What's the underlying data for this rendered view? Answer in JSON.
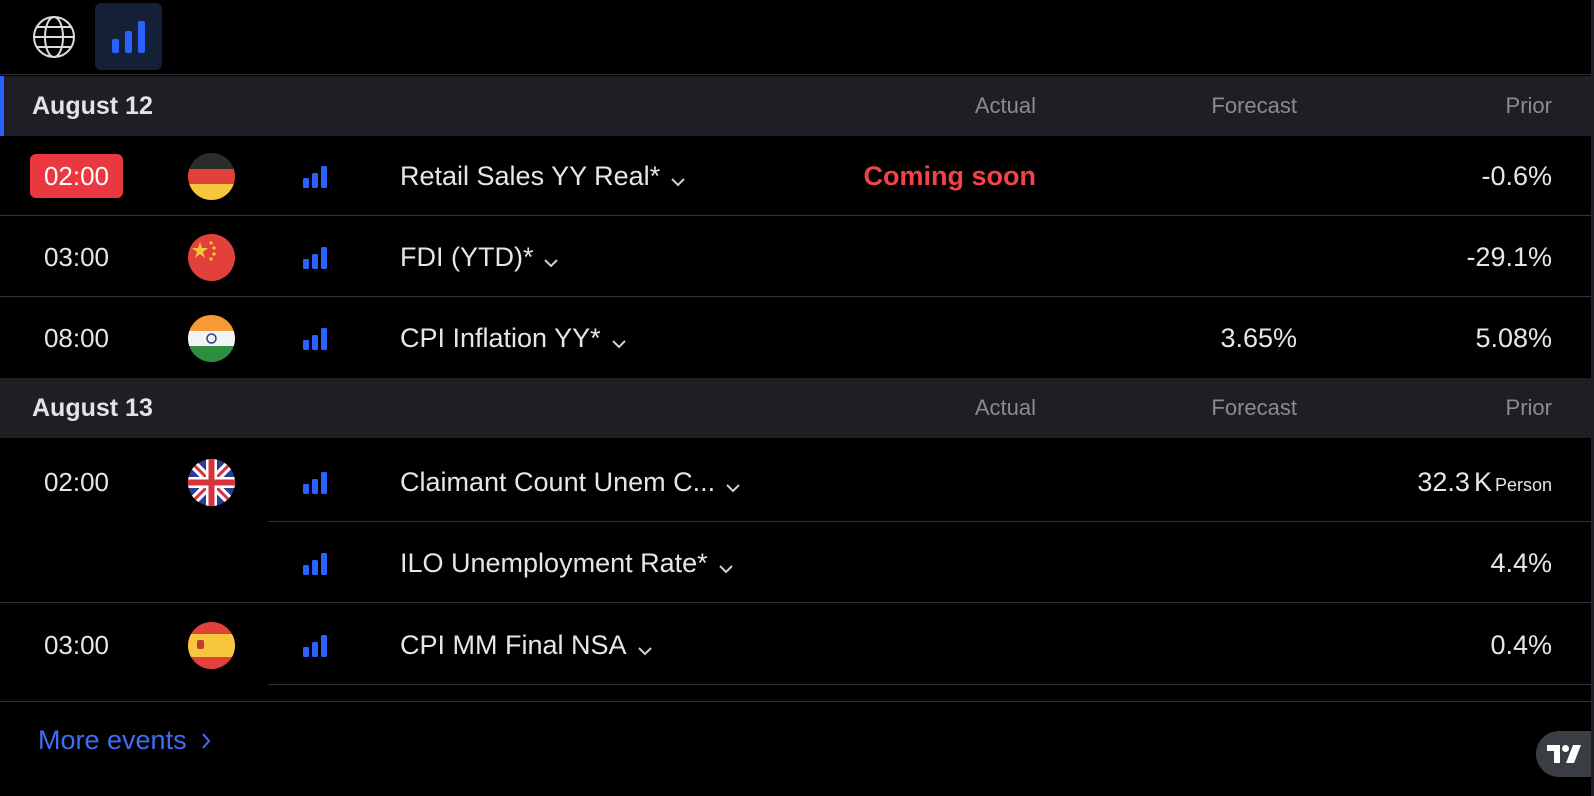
{
  "colors": {
    "accent": "#2962ff",
    "live": "#e9383f",
    "coming_soon": "#f2434a",
    "link": "#3f6ef5"
  },
  "toolbar": {
    "icons": [
      "globe-icon",
      "importance-bars-icon"
    ]
  },
  "days": [
    {
      "title": "August 12",
      "columns": {
        "actual": "Actual",
        "forecast": "Forecast",
        "prior": "Prior"
      },
      "events": [
        {
          "time": "02:00",
          "live": true,
          "country_icon": "germany-flag-icon",
          "name": "Retail Sales YY Real*",
          "actual": "Coming soon",
          "forecast": "",
          "prior": "-0.6%"
        },
        {
          "time": "03:00",
          "country_icon": "china-flag-icon",
          "name": "FDI (YTD)*",
          "actual": "",
          "forecast": "",
          "prior": "-29.1%"
        },
        {
          "time": "08:00",
          "country_icon": "india-flag-icon",
          "name": "CPI Inflation YY*",
          "actual": "",
          "forecast": "3.65%",
          "prior": "5.08%"
        }
      ]
    },
    {
      "title": "August 13",
      "columns": {
        "actual": "Actual",
        "forecast": "Forecast",
        "prior": "Prior"
      },
      "events": [
        {
          "time": "02:00",
          "country_icon": "uk-flag-icon",
          "name": "Claimant Count Unem C...",
          "actual": "",
          "forecast": "",
          "prior_value": "32.3",
          "prior_unit": "K",
          "prior_suffix": "Person"
        },
        {
          "time": "",
          "country_icon": "",
          "name": "ILO Unemployment Rate*",
          "actual": "",
          "forecast": "",
          "prior": "4.4%"
        },
        {
          "time": "03:00",
          "country_icon": "spain-flag-icon",
          "name": "CPI MM Final NSA",
          "actual": "",
          "forecast": "",
          "prior": "0.4%"
        }
      ]
    }
  ],
  "footer": {
    "more_events": "More events",
    "brand_icon": "tradingview-logo-icon"
  }
}
